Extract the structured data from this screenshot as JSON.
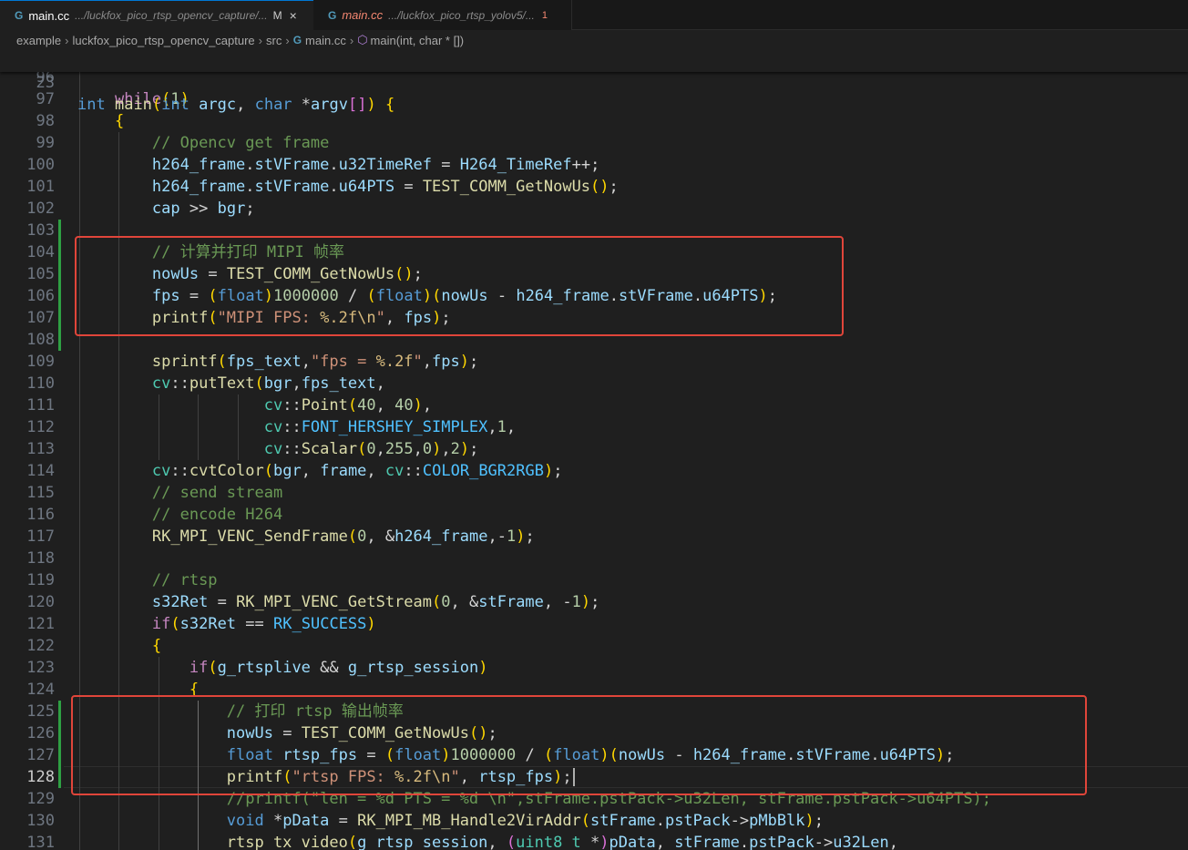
{
  "tabs": [
    {
      "icon": "c-file-icon",
      "name": "main.cc",
      "path": ".../luckfox_pico_rtsp_opencv_capture/...",
      "badge": "M",
      "close": "×"
    },
    {
      "icon": "c-file-icon",
      "name": "main.cc",
      "path": ".../luckfox_pico_rtsp_yolov5/...",
      "badge": "1"
    }
  ],
  "breadcrumb": [
    "example",
    "luckfox_pico_rtsp_opencv_capture",
    "src",
    "main.cc",
    "main(int, char * [])"
  ],
  "sticky": {
    "num": "23",
    "text": "int main(int argc, char *argv[]) {"
  },
  "lines": [
    {
      "n": "96",
      "code": ""
    },
    {
      "n": "97",
      "code": "    while(1)"
    },
    {
      "n": "98",
      "code": "    {"
    },
    {
      "n": "99",
      "code": "        // Opencv get frame"
    },
    {
      "n": "100",
      "code": "        h264_frame.stVFrame.u32TimeRef = H264_TimeRef++;"
    },
    {
      "n": "101",
      "code": "        h264_frame.stVFrame.u64PTS = TEST_COMM_GetNowUs();"
    },
    {
      "n": "102",
      "code": "        cap >> bgr;"
    },
    {
      "n": "103",
      "code": ""
    },
    {
      "n": "104",
      "code": "        // 计算并打印 MIPI 帧率"
    },
    {
      "n": "105",
      "code": "        nowUs = TEST_COMM_GetNowUs();"
    },
    {
      "n": "106",
      "code": "        fps = (float)1000000 / (float)(nowUs - h264_frame.stVFrame.u64PTS);"
    },
    {
      "n": "107",
      "code": "        printf(\"MIPI FPS: %.2f\\n\", fps);"
    },
    {
      "n": "108",
      "code": ""
    },
    {
      "n": "109",
      "code": "        sprintf(fps_text,\"fps = %.2f\",fps);"
    },
    {
      "n": "110",
      "code": "        cv::putText(bgr,fps_text,"
    },
    {
      "n": "111",
      "code": "                    cv::Point(40, 40),"
    },
    {
      "n": "112",
      "code": "                    cv::FONT_HERSHEY_SIMPLEX,1,"
    },
    {
      "n": "113",
      "code": "                    cv::Scalar(0,255,0),2);"
    },
    {
      "n": "114",
      "code": "        cv::cvtColor(bgr, frame, cv::COLOR_BGR2RGB);"
    },
    {
      "n": "115",
      "code": "        // send stream"
    },
    {
      "n": "116",
      "code": "        // encode H264"
    },
    {
      "n": "117",
      "code": "        RK_MPI_VENC_SendFrame(0, &h264_frame,-1);"
    },
    {
      "n": "118",
      "code": ""
    },
    {
      "n": "119",
      "code": "        // rtsp"
    },
    {
      "n": "120",
      "code": "        s32Ret = RK_MPI_VENC_GetStream(0, &stFrame, -1);"
    },
    {
      "n": "121",
      "code": "        if(s32Ret == RK_SUCCESS)"
    },
    {
      "n": "122",
      "code": "        {"
    },
    {
      "n": "123",
      "code": "            if(g_rtsplive && g_rtsp_session)"
    },
    {
      "n": "124",
      "code": "            {"
    },
    {
      "n": "125",
      "code": "                // 打印 rtsp 输出帧率"
    },
    {
      "n": "126",
      "code": "                nowUs = TEST_COMM_GetNowUs();"
    },
    {
      "n": "127",
      "code": "                float rtsp_fps = (float)1000000 / (float)(nowUs - h264_frame.stVFrame.u64PTS);"
    },
    {
      "n": "128",
      "code": "                printf(\"rtsp FPS: %.2f\\n\", rtsp_fps);"
    },
    {
      "n": "129",
      "code": "                //printf(\"len = %d PTS = %d \\n\",stFrame.pstPack->u32Len, stFrame.pstPack->u64PTS);"
    },
    {
      "n": "130",
      "code": "                void *pData = RK_MPI_MB_Handle2VirAddr(stFrame.pstPack->pMbBlk);"
    },
    {
      "n": "131",
      "code": "                rtsp_tx_video(g_rtsp_session, (uint8_t *)pData, stFrame.pstPack->u32Len,"
    }
  ],
  "current_line": "128",
  "colors": {
    "highlight_box": "#e0453a",
    "added_gutter": "#2ea043",
    "background": "#1f1f1f"
  }
}
